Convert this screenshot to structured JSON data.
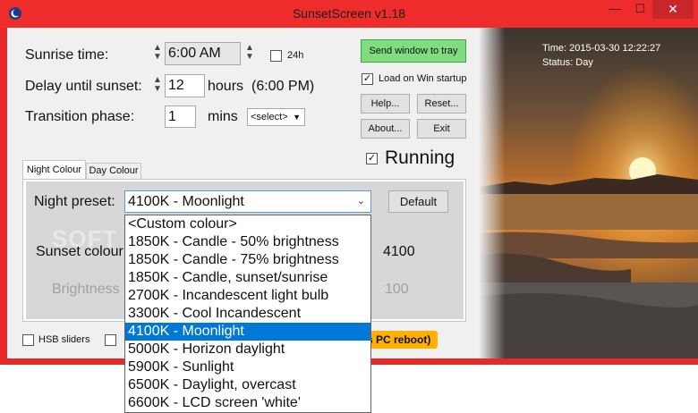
{
  "window": {
    "title": "SunsetScreen v1.18",
    "minimize_glyph": "—",
    "maximize_glyph": "☐",
    "close_glyph": "✕"
  },
  "settings": {
    "sunrise_label": "Sunrise time:",
    "sunrise_value": "6:00 AM",
    "h24_label": "24h",
    "delay_label": "Delay until sunset:",
    "delay_value": "12",
    "delay_unit": "hours",
    "delay_note": "(6:00 PM)",
    "transition_label": "Transition phase:",
    "transition_value": "1",
    "transition_unit": "mins",
    "transition_select": "<select>"
  },
  "buttons": {
    "send_tray": "Send window to tray",
    "load_startup": "Load on Win startup",
    "help": "Help...",
    "reset": "Reset...",
    "about": "About...",
    "exit": "Exit",
    "running": "Running",
    "default": "Default"
  },
  "status": {
    "time": "Time: 2015-03-30 12:22:27",
    "status": "Status: Day"
  },
  "tabs": [
    "Night Colour",
    "Day Colour"
  ],
  "night_panel": {
    "preset_label": "Night preset:",
    "preset_value": "4100K - Moonlight",
    "sunset_colour_label": "Sunset colour",
    "sunset_colour_value": "4100",
    "brightness_label": "Brightness",
    "brightness_value": "100",
    "watermark": "SOFT"
  },
  "bottom": {
    "hsb_label": "HSB sliders",
    "reboot_fragment": "s PC reboot)"
  },
  "preset_options": [
    "<Custom colour>",
    "1850K - Candle - 50% brightness",
    "1850K - Candle - 75% brightness",
    "1850K - Candle, sunset/sunrise",
    "2700K - Incandescent light bulb",
    "3300K - Cool Incandescent",
    "4100K - Moonlight",
    "5000K - Horizon daylight",
    "5900K - Sunlight",
    "6500K - Daylight, overcast",
    "6600K - LCD screen 'white'"
  ],
  "selected_option_index": 6,
  "colors": {
    "title_bar": "#ef2c2c",
    "close_button": "#c7262a",
    "tray_button": "#7fdc7f",
    "reboot_highlight": "#ffb000",
    "selection": "#0078d7"
  }
}
